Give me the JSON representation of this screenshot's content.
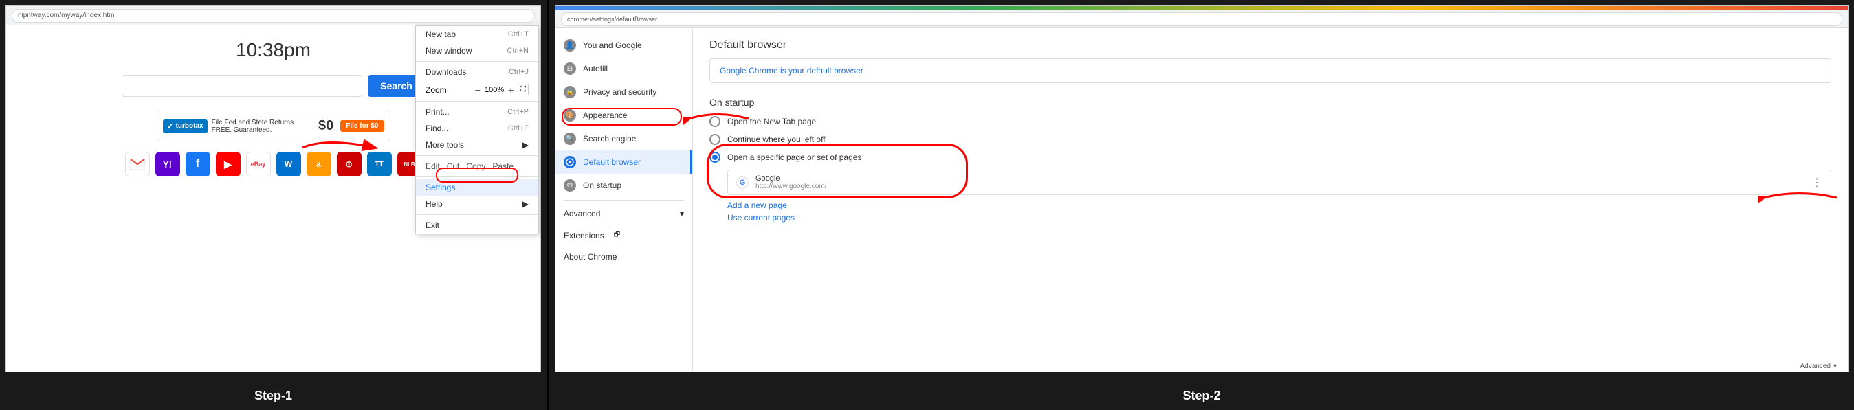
{
  "left": {
    "step_label": "Step-1",
    "clock": "10:38pm",
    "url_bar": "nipntway.com/myway/index.html",
    "search_placeholder": "",
    "search_btn_label": "Search",
    "ad": {
      "brand": "turbotax",
      "text": "File Fed and State Returns FREE. Guaranteed.",
      "price": "File for $0"
    },
    "menu": {
      "items": [
        {
          "label": "New tab",
          "shortcut": "Ctrl+T"
        },
        {
          "label": "New window",
          "shortcut": "Ctrl+N"
        },
        {
          "label": "Downloads",
          "shortcut": "Ctrl+J"
        },
        {
          "label": "Zoom",
          "value": "100%"
        },
        {
          "label": "Print...",
          "shortcut": "Ctrl+P"
        },
        {
          "label": "Find...",
          "shortcut": "Ctrl+F"
        },
        {
          "label": "More tools",
          "arrow": true
        },
        {
          "label": "Edit",
          "sub": [
            "Cut",
            "Copy",
            "Paste"
          ]
        },
        {
          "label": "Settings",
          "highlighted": true
        },
        {
          "label": "Help",
          "arrow": true
        },
        {
          "label": "Exit"
        }
      ]
    }
  },
  "right": {
    "step_label": "Step-2",
    "settings_url": "chrome://settings/defaultBrowser",
    "sidebar": {
      "items": [
        {
          "icon": "person",
          "label": "You and Google"
        },
        {
          "icon": "fill",
          "label": "Autofill"
        },
        {
          "icon": "lock",
          "label": "Privacy and security"
        },
        {
          "icon": "palette",
          "label": "Appearance"
        },
        {
          "icon": "search",
          "label": "Search engine"
        },
        {
          "icon": "chrome",
          "label": "Default browser",
          "active": true
        },
        {
          "icon": "power",
          "label": "On startup"
        },
        {
          "label": "Advanced",
          "dropdown": true
        },
        {
          "label": "Extensions",
          "external": true
        },
        {
          "label": "About Chrome"
        }
      ]
    },
    "default_browser": {
      "title": "Default browser",
      "value": "Google Chrome is your default browser"
    },
    "on_startup": {
      "title": "On startup",
      "options": [
        {
          "label": "Open the New Tab page",
          "selected": false
        },
        {
          "label": "Continue where you left off",
          "selected": false
        },
        {
          "label": "Open a specific page or set of pages",
          "selected": true
        }
      ],
      "page_entry": {
        "name": "Google",
        "url": "http://www.google.com/"
      },
      "add_new": "Add a new page",
      "use_current": "Use current pages"
    },
    "bottom_bar": {
      "label": "Advanced",
      "arrow": "▾"
    }
  }
}
